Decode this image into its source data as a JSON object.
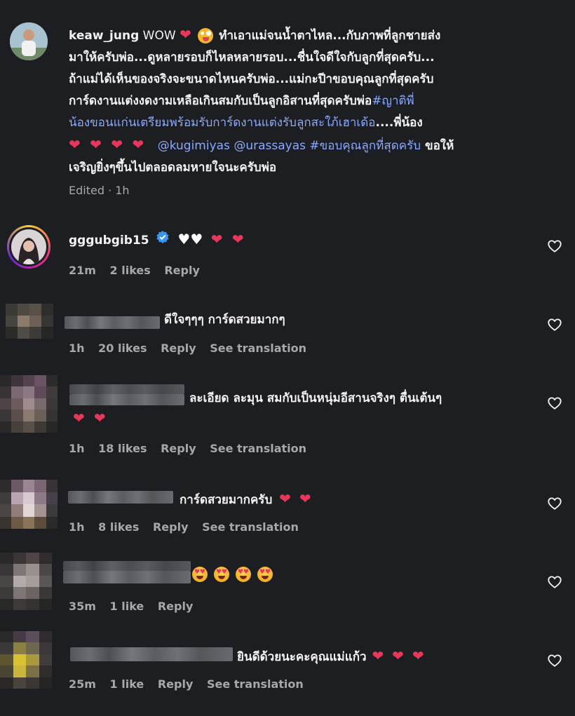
{
  "comments": [
    {
      "username": "keaw_jung",
      "lines": [
        " WOW ",
        "มาให้ครับพ่อ...ดูหลายรอบก็ไหลหลายรอบ...ชื่นใจดีใจกับลูกที่สุดครับ...",
        "ถ้าแม่ได้เห็นของจริงจะขนาดไหนครับพ่อ...แม่กะปีาขอบคุณลูกที่สุดครับ",
        "การ์ดงานแต่งงดงามเหลือเกินสมกับเป็นลูกอิสานที่สุดครับพ่อ",
        "น้องขอนแก่นเตรียมพร้อมรับการ์ดงานแต่งรับลูกสะใภ้เฮาเด้อ",
        "เจริญยิ่งๆขึ้นไปตลอดลมหายใจนะครับพ่อ"
      ],
      "line1_rest": "ทำเอาแม่จนน้ำตาไหล...กับภาพที่ลูกชายส่ง",
      "hashtag1_part1": "#ญาติพี่",
      "hashtag1_part2": "",
      "after_hashtag1": "....พี่น้อง",
      "mention1": "@kugimiyas",
      "mention2": "@urassayas",
      "hashtag2": "#ขอบคุณลูกที่สุดครับ",
      "after_hashtag2": " ขอให้",
      "meta": "Edited · 1h"
    },
    {
      "username": "gggubgib15",
      "verified": true,
      "time": "21m",
      "likes": "2 likes",
      "reply": "Reply"
    },
    {
      "text": "ดีใจๆๆๆ การ์ดสวยมากๆ",
      "time": "1h",
      "likes": "20 likes",
      "reply": "Reply",
      "translate": "See translation"
    },
    {
      "text": "ละเอียด ละมุน สมกับเป็นหนุ่มอีสานจริงๆ ตื่นเต้นๆ",
      "time": "1h",
      "likes": "18 likes",
      "reply": "Reply",
      "translate": "See translation"
    },
    {
      "text": "การ์ดสวยมากครับ",
      "time": "1h",
      "likes": "8 likes",
      "reply": "Reply",
      "translate": "See translation"
    },
    {
      "time": "35m",
      "likes": "1 like",
      "reply": "Reply"
    },
    {
      "text": "ยินดีด้วยนะคะคุณแม่แก้ว",
      "time": "25m",
      "likes": "1 like",
      "reply": "Reply",
      "translate": "See translation"
    }
  ],
  "icons": {
    "heart_outline": "heart-outline-icon",
    "verified": "verified-badge-icon",
    "heart": "red-heart-emoji",
    "white_heart": "white-heart-emoji",
    "heart_eyes": "heart-eyes-emoji",
    "zany_face": "zany-face-emoji"
  },
  "colors": {
    "background": "#1d1e22",
    "link": "#8aa8ff",
    "heart": "#e8375a",
    "verified": "#3897f0",
    "muted": "#a8a8a8"
  }
}
